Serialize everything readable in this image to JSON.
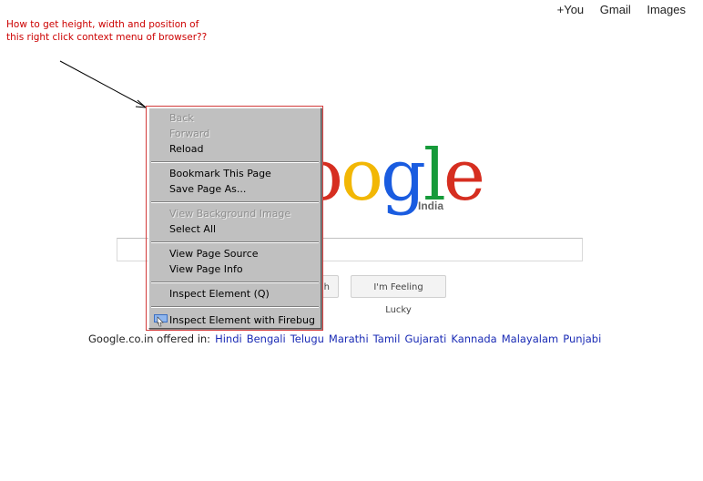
{
  "topnav": {
    "plus": "+You",
    "gmail": "Gmail",
    "images": "Images"
  },
  "annotation": {
    "line1": "How to get height, width and position of",
    "line2": "this right click context menu of browser??"
  },
  "logo": {
    "text": "oogle",
    "region": "India"
  },
  "buttons": {
    "search": "h",
    "lucky": "I'm Feeling Lucky"
  },
  "offered": {
    "label": "Google.co.in offered in:",
    "languages": [
      "Hindi",
      "Bengali",
      "Telugu",
      "Marathi",
      "Tamil",
      "Gujarati",
      "Kannada",
      "Malayalam",
      "Punjabi"
    ]
  },
  "context_menu": {
    "back": "Back",
    "forward": "Forward",
    "reload": "Reload",
    "bookmark": "Bookmark This Page",
    "save": "Save Page As...",
    "view_bg": "View Background Image",
    "select_all": "Select All",
    "view_source": "View Page Source",
    "page_info": "View Page Info",
    "inspect": "Inspect Element (Q)",
    "inspect_firebug": "Inspect Element with Firebug"
  },
  "colors": {
    "blue": "#1a5ce0",
    "red": "#d62e20",
    "yellow": "#f2b705",
    "green": "#169a3a",
    "annotation": "#cc0000"
  }
}
